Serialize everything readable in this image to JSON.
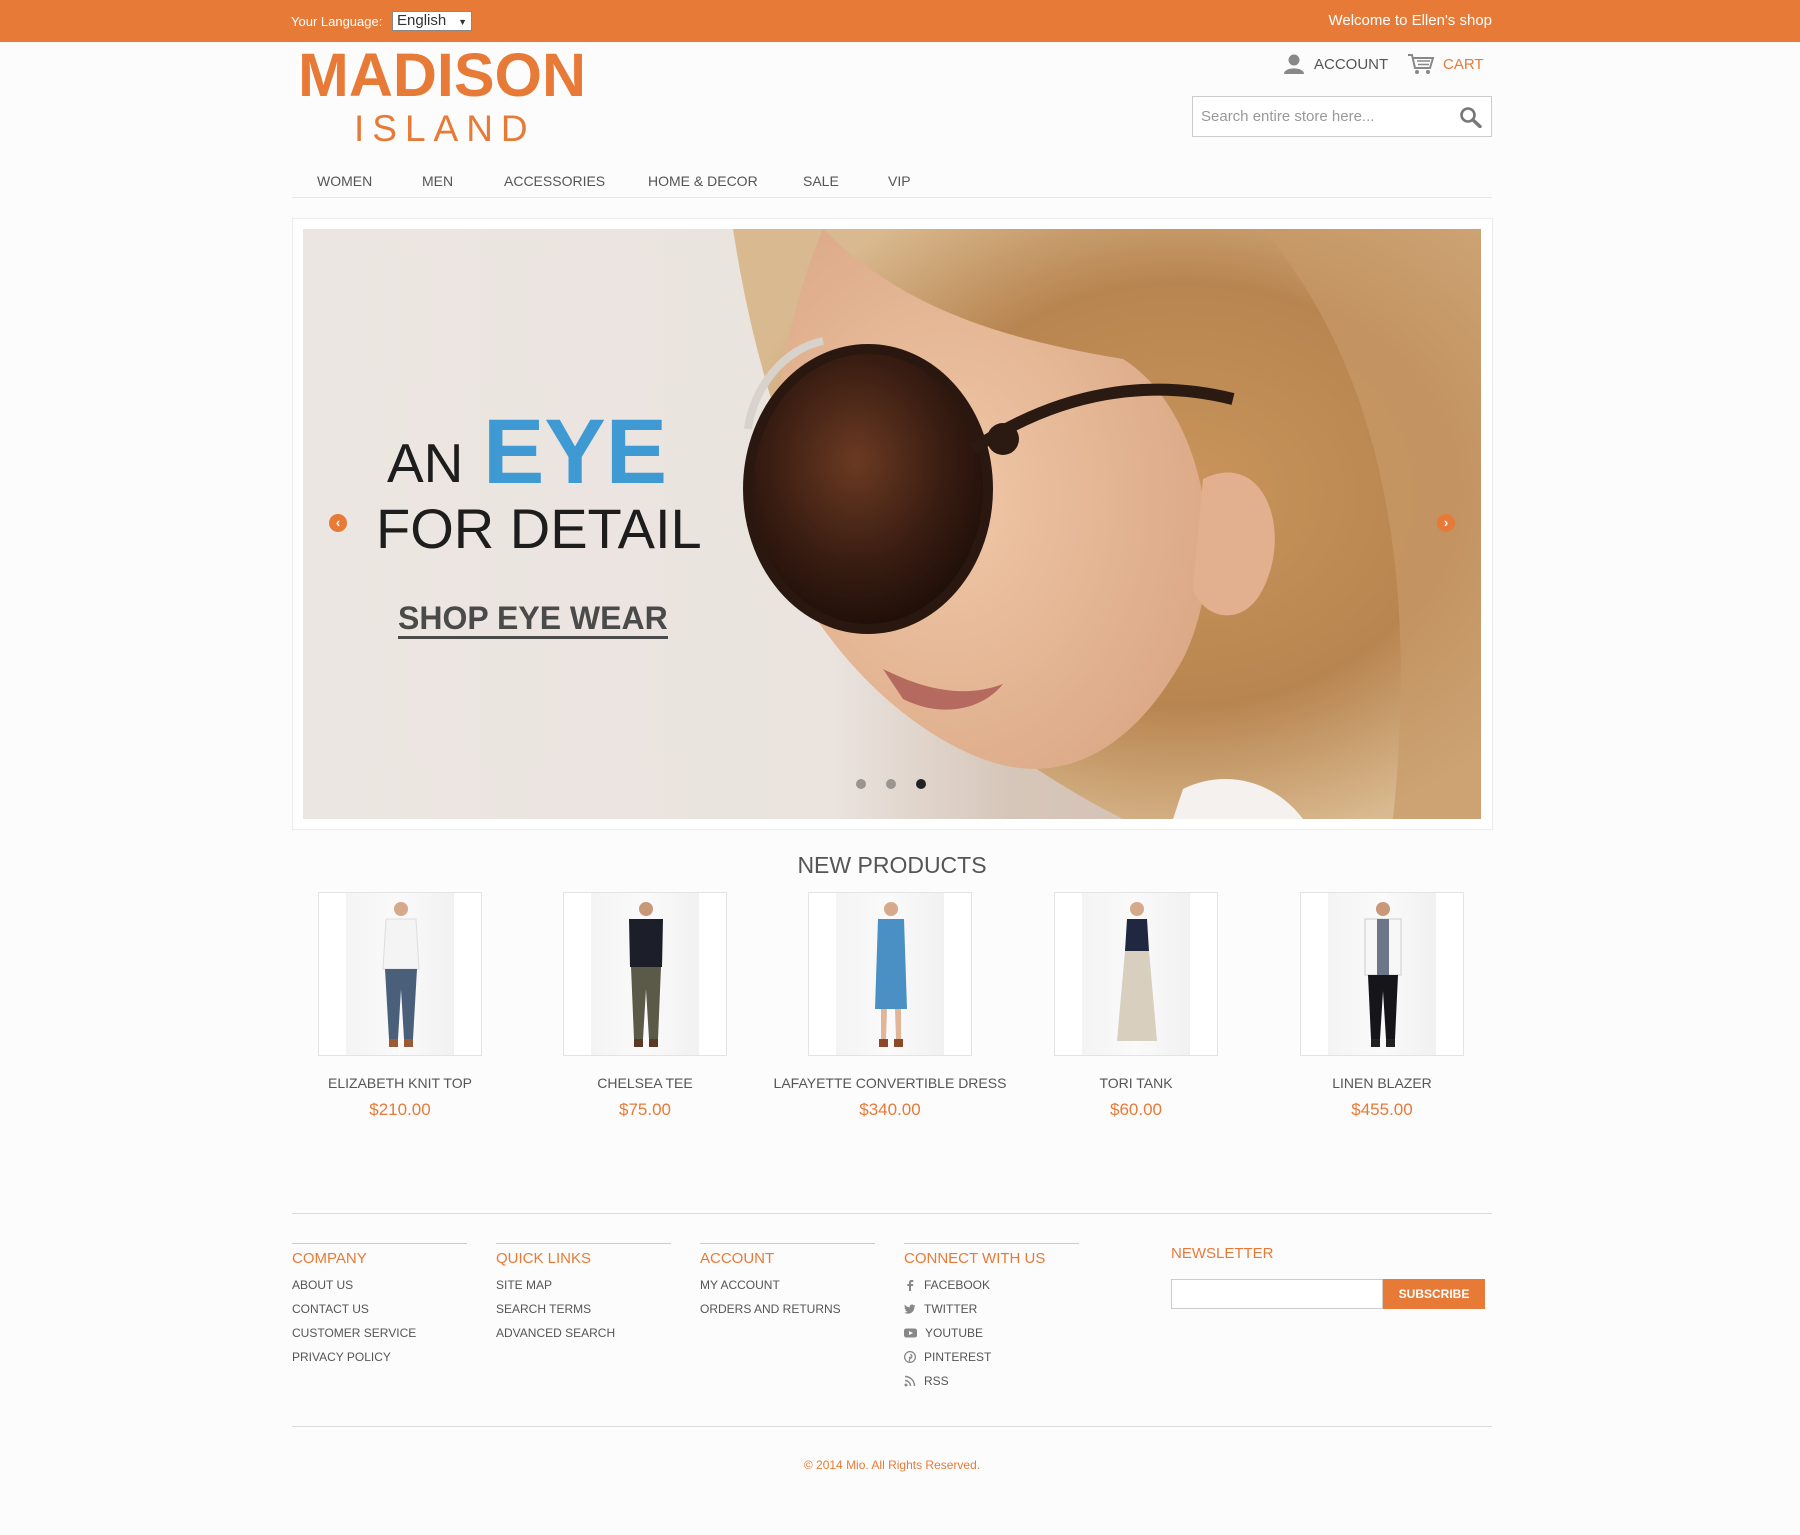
{
  "topbar": {
    "language_label": "Your Language:",
    "language_value": "English",
    "welcome": "Welcome to Ellen's shop"
  },
  "header": {
    "logo_line1": "MADISON",
    "logo_line2": "ISLAND",
    "account_label": "ACCOUNT",
    "cart_label": "CART",
    "search_placeholder": "Search entire store here..."
  },
  "nav": {
    "items": [
      "WOMEN",
      "MEN",
      "ACCESSORIES",
      "HOME & DECOR",
      "SALE",
      "VIP"
    ]
  },
  "hero": {
    "line_an": "AN",
    "line_eye": "EYE",
    "line_detail": "FOR DETAIL",
    "cta": "SHOP EYE WEAR",
    "slide_count": 3,
    "active_slide": 3
  },
  "new_products": {
    "title": "NEW PRODUCTS",
    "items": [
      {
        "name": "ELIZABETH KNIT TOP",
        "price": "$210.00"
      },
      {
        "name": "CHELSEA TEE",
        "price": "$75.00"
      },
      {
        "name": "LAFAYETTE CONVERTIBLE DRESS",
        "price": "$340.00"
      },
      {
        "name": "TORI TANK",
        "price": "$60.00"
      },
      {
        "name": "LINEN BLAZER",
        "price": "$455.00"
      }
    ]
  },
  "footer": {
    "company": {
      "title": "COMPANY",
      "links": [
        "ABOUT US",
        "CONTACT US",
        "CUSTOMER SERVICE",
        "PRIVACY POLICY"
      ]
    },
    "quick_links": {
      "title": "QUICK LINKS",
      "links": [
        "SITE MAP",
        "SEARCH TERMS",
        "ADVANCED SEARCH"
      ]
    },
    "account": {
      "title": "ACCOUNT",
      "links": [
        "MY ACCOUNT",
        "ORDERS AND RETURNS"
      ]
    },
    "connect": {
      "title": "CONNECT WITH US",
      "links": [
        "FACEBOOK",
        "TWITTER",
        "YOUTUBE",
        "PINTEREST",
        "RSS"
      ]
    },
    "newsletter": {
      "title": "NEWSLETTER",
      "button": "SUBSCRIBE"
    },
    "copyright": "© 2014 Mio. All Rights Reserved."
  },
  "colors": {
    "accent": "#e87a37",
    "eye_blue": "#3f9ad3"
  }
}
